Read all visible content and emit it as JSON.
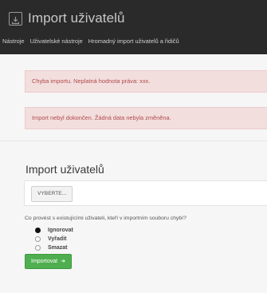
{
  "header": {
    "title": "Import uživatelů",
    "app_icon": "import-icon"
  },
  "breadcrumb": {
    "items": [
      "Nástroje",
      "Uživatelské nástroje",
      "Hromadný import uživatelů a řidičů"
    ]
  },
  "alerts": {
    "error_1": "Chyba importu. Neplatná hodnota práva: xxx.",
    "error_2": "Import nebyl dokončen. Žádná data nebyla změněna."
  },
  "import_form": {
    "heading": "Import uživatelů",
    "file_button_label": "VYBERTE...",
    "question": "Co provést s existujícími uživateli, kteří v importním souboru chybí?",
    "options": [
      {
        "label": "Ignorovat",
        "selected": true
      },
      {
        "label": "Vyřadit",
        "selected": false
      },
      {
        "label": "Smazat",
        "selected": false
      }
    ],
    "submit_label": "Importovat",
    "submit_arrow": "➔"
  },
  "colors": {
    "topbar": "#2a2a2a",
    "alert_bg": "#f3dede",
    "alert_text": "#b04a4a",
    "submit_bg": "#4fae4f"
  }
}
